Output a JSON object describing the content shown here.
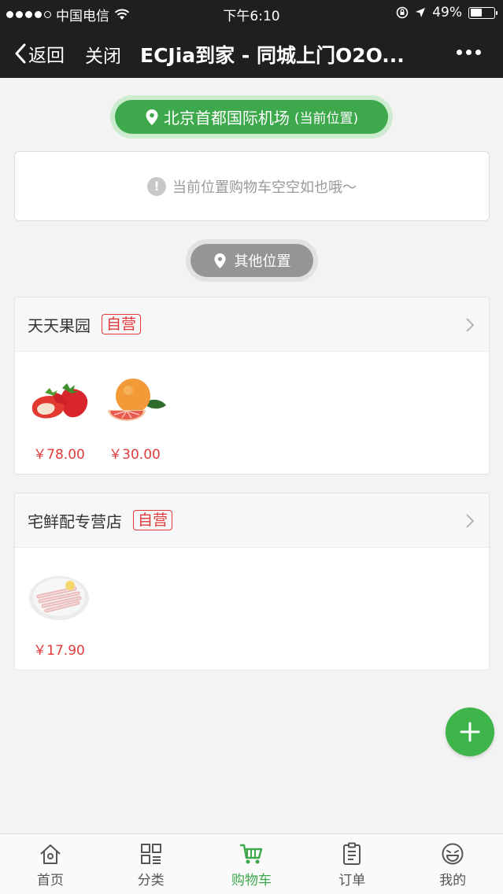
{
  "status_bar": {
    "carrier": "中国电信",
    "time": "下午6:10",
    "battery": "49%",
    "battery_level": 0.49
  },
  "nav": {
    "back_label": "返回",
    "close_label": "关闭",
    "title": "ECJia到家 - 同城上门O2O..."
  },
  "current_location": {
    "name": "北京首都国际机场",
    "tag": "(当前位置)"
  },
  "empty_cart": {
    "message": "当前位置购物车空空如也哦～"
  },
  "other_location": {
    "label": "其他位置"
  },
  "stores": [
    {
      "name": "天天果园",
      "badge": "自营",
      "products": [
        {
          "image": "strawberry-image",
          "price": "￥78.00"
        },
        {
          "image": "grapefruit-image",
          "price": "￥30.00"
        }
      ]
    },
    {
      "name": "宅鲜配专营店",
      "badge": "自营",
      "products": [
        {
          "image": "shrimp-plate-image",
          "price": "￥17.90"
        }
      ]
    }
  ],
  "tabs": [
    {
      "label": "首页",
      "icon": "home-icon",
      "active": false
    },
    {
      "label": "分类",
      "icon": "category-icon",
      "active": false
    },
    {
      "label": "购物车",
      "icon": "cart-icon",
      "active": true
    },
    {
      "label": "订单",
      "icon": "order-icon",
      "active": false
    },
    {
      "label": "我的",
      "icon": "profile-icon",
      "active": false
    }
  ],
  "colors": {
    "accent_green": "#3ea94c",
    "price_red": "#e23a3a",
    "nav_bg": "#1f1f1f"
  }
}
